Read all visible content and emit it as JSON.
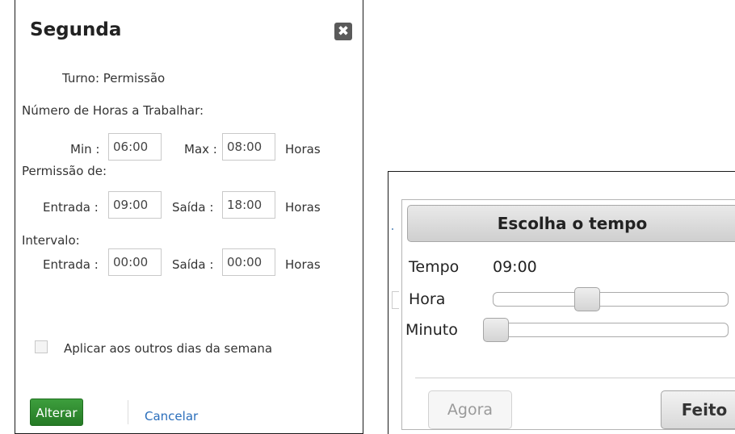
{
  "dialog": {
    "title": "Segunda",
    "turno": "Turno: Permissão",
    "numero_horas": "Número de Horas a Trabalhar:",
    "min_label": "Min :",
    "min_value": "06:00",
    "max_label": "Max :",
    "max_value": "08:00",
    "horas_1": "Horas",
    "permissao_de": "Permissão de:",
    "perm_entrada_label": "Entrada :",
    "perm_entrada_value": "09:00",
    "perm_saida_label": "Saída :",
    "perm_saida_value": "18:00",
    "horas_2": "Horas",
    "intervalo": "Intervalo:",
    "int_entrada_label": "Entrada :",
    "int_entrada_value": "00:00",
    "int_saida_label": "Saída :",
    "int_saida_value": "00:00",
    "horas_3": "Horas",
    "aplicar": "Aplicar aos outros dias da semana",
    "alterar": "Alterar",
    "cancelar": "Cancelar",
    "close_icon": "close-x-icon"
  },
  "picker": {
    "title": "Escolha o tempo",
    "tempo_label": "Tempo",
    "tempo_value": "09:00",
    "hora_label": "Hora",
    "hora_level": 0.39,
    "minuto_label": "Minuto",
    "minuto_level": 0.0,
    "agora": "Agora",
    "feito": "Feito"
  },
  "colors": {
    "accent_green": "#2e8b2e",
    "link_blue": "#2a6ebb"
  }
}
